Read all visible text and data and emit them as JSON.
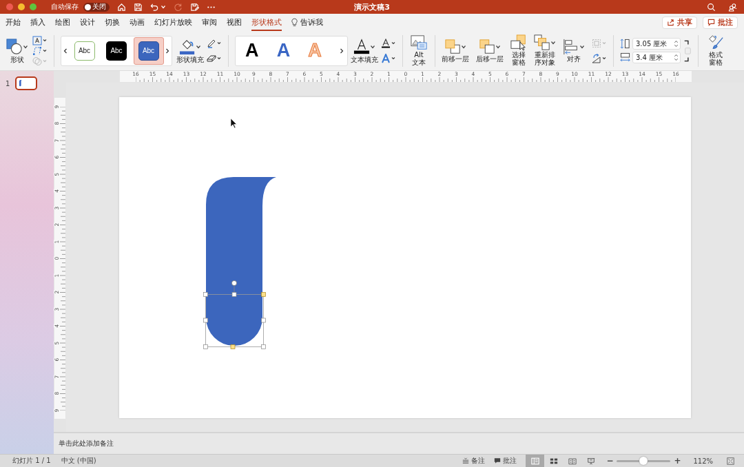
{
  "window": {
    "title": "演示文稿3",
    "autosave_label": "自动保存",
    "autosave_toggle": {
      "on": false,
      "label": "关闭"
    }
  },
  "tabs": [
    {
      "label": "开始",
      "selected": false
    },
    {
      "label": "插入",
      "selected": false
    },
    {
      "label": "绘图",
      "selected": false
    },
    {
      "label": "设计",
      "selected": false
    },
    {
      "label": "切换",
      "selected": false
    },
    {
      "label": "动画",
      "selected": false
    },
    {
      "label": "幻灯片放映",
      "selected": false
    },
    {
      "label": "审阅",
      "selected": false
    },
    {
      "label": "视图",
      "selected": false
    },
    {
      "label": "形状格式",
      "selected": true
    }
  ],
  "tell_me": "告诉我",
  "share_button": "共享",
  "comments_button": "批注",
  "ribbon": {
    "shapes_label": "形状",
    "style_gallery": [
      {
        "label": "Abc",
        "kind": "outline",
        "selected": false
      },
      {
        "label": "Abc",
        "kind": "dark",
        "selected": false
      },
      {
        "label": "Abc",
        "kind": "filled",
        "selected": true
      }
    ],
    "shape_fill_label": "形状填充",
    "wordart_gallery": [
      {
        "label": "A",
        "kind": "plain"
      },
      {
        "label": "A",
        "kind": "blue"
      },
      {
        "label": "A",
        "kind": "outline"
      }
    ],
    "text_fill_label": "文本填充",
    "alt_text_lines": [
      "Alt",
      "文本"
    ],
    "arrange": [
      {
        "kind": "forward",
        "lines": [
          "前移一层"
        ]
      },
      {
        "kind": "backward",
        "lines": [
          "后移一层"
        ]
      },
      {
        "kind": "selection",
        "lines": [
          "选择",
          "窗格"
        ]
      },
      {
        "kind": "reorder",
        "lines": [
          "重新排",
          "序对象"
        ]
      },
      {
        "kind": "align",
        "lines": [
          "对齐"
        ]
      }
    ],
    "height": "3.05 厘米",
    "width": "3.4 厘米",
    "format_pane_lines": [
      "格式",
      "窗格"
    ]
  },
  "rulers": {
    "horizontal": [
      "16",
      "15",
      "14",
      "13",
      "12",
      "11",
      "10",
      "9",
      "8",
      "7",
      "6",
      "5",
      "4",
      "3",
      "2",
      "1",
      "0",
      "1",
      "2",
      "3",
      "4",
      "5",
      "6",
      "7",
      "8",
      "9",
      "10",
      "11",
      "12",
      "13",
      "14",
      "15",
      "16"
    ],
    "vertical": [
      "9",
      "8",
      "7",
      "6",
      "5",
      "4",
      "3",
      "2",
      "1",
      "0",
      "1",
      "2",
      "3",
      "4",
      "5",
      "6",
      "7",
      "8",
      "9"
    ]
  },
  "slides": [
    {
      "number": "1",
      "selected": true
    }
  ],
  "notes_placeholder": "单击此处添加备注",
  "status_bar": {
    "slide": "幻灯片 1 / 1",
    "language": "中文 (中国)",
    "notes": "备注",
    "comments": "批注",
    "views": [
      {
        "kind": "normal",
        "selected": true
      },
      {
        "kind": "sorter",
        "selected": false
      },
      {
        "kind": "reading",
        "selected": false
      },
      {
        "kind": "slideshow",
        "selected": false
      }
    ],
    "zoom_minus": "−",
    "zoom_plus": "+",
    "zoom": {
      "level": 0.5
    },
    "zoom_percent": "112%"
  }
}
